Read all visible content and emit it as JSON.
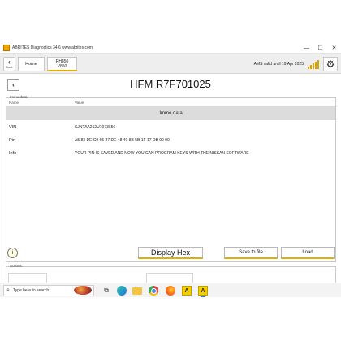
{
  "window": {
    "title": "ABRITES Diagnostics 34.6  www.abrites.com",
    "minimize": "—",
    "maximize": "☐",
    "close": "✕"
  },
  "toolbar": {
    "back_label": "Back",
    "home_label": "Home",
    "module_line1": "RH850",
    "module_line2": "V850",
    "ams_text": "AMS valid until 19 Apr 2025",
    "accent_color": "#e0b000"
  },
  "page": {
    "title": "HFM R7F701025"
  },
  "immo": {
    "group_label": "Immo data:",
    "col_name": "Name",
    "col_value": "Value",
    "section_title": "Immo data",
    "rows": [
      {
        "name": "VIN",
        "value": "SJNTAA212U1073656"
      },
      {
        "name": "Pin",
        "value": "A5 83 DE C9 65 27 DE 48 40 8B 5B 1F 17 DB 00 00"
      },
      {
        "name": "Info",
        "value": "YOUR PIN IS SAVED AND NOW YOU CAN PROGRAM KEYS WITH THE NISSAN SOFTWARE"
      }
    ]
  },
  "buttons": {
    "info": "i",
    "display_hex": "Display Hex",
    "save_to_file": "Save to file",
    "load": "Load"
  },
  "actions": {
    "label": "Actions:"
  },
  "taskbar": {
    "search_placeholder": "Type here to search",
    "apps": [
      "task-view",
      "edge",
      "file-explorer",
      "chrome",
      "firefox",
      "abrites",
      "abrites-active"
    ]
  }
}
